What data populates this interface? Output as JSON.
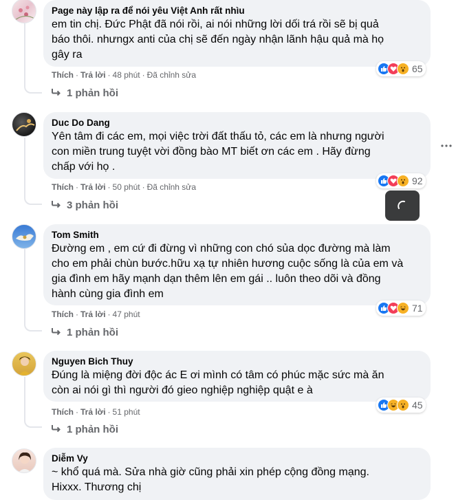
{
  "actions": {
    "like": "Thích",
    "reply": "Trả lời",
    "edited": "Đã chỉnh sửa",
    "separator": "·"
  },
  "comments": [
    {
      "author": "Page này lập ra để nói yêu Việt Anh rất nhìu",
      "text": "em tin chị. Đức Phật đã nói rồi, ai nói những lời dối trá rồi sẽ bị quả\nbáo thôi. nhưngx anti của chị sẽ đến ngày nhận lãnh hậu quả mà họ\ngây ra",
      "time": "48 phút",
      "reaction_count": "65",
      "reactions": [
        "like-icon",
        "love-icon",
        "wow-icon"
      ],
      "replies": "1 phản hồi"
    },
    {
      "author": "Duc Do Dang",
      "text": "Yên tâm đi các em, mọi việc trời đất thấu tỏ, các em là nhưng người\ncon miền trung tuyệt vời đồng bào MT biết ơn các em . Hãy đừng\nchấp với họ .",
      "time": "50 phút",
      "reaction_count": "92",
      "reactions": [
        "like-icon",
        "love-icon",
        "wow-icon"
      ],
      "replies": "3 phản hồi"
    },
    {
      "author": "Tom Smith",
      "text": "Đường em , em cứ đi đừng vì những con chó sủa dọc đường mà làm\ncho em phải chùn bước.hữu xạ tự nhiên hương cuộc sống là của em và\ngia đình em hãy mạnh dạn thêm lên em gái .. luôn theo dõi và đồng\nhành cùng gia đình em",
      "time": "47 phút",
      "reaction_count": "71",
      "reactions": [
        "like-icon",
        "love-icon",
        "haha-icon"
      ],
      "replies": "1 phản hồi"
    },
    {
      "author": "Nguyen Bich Thuy",
      "text": "Đúng là miệng đời độc ác E ơi mình có tâm có phúc mặc sức mà ăn\ncòn ai nói gì thì người đó gieo nghiệp nghiệp quật e à",
      "time": "51 phút",
      "reaction_count": "45",
      "reactions": [
        "like-icon",
        "haha-icon",
        "wow-icon"
      ],
      "replies": "1 phản hồi"
    },
    {
      "author": "Diễm Vy",
      "text": "~ khổ quá mà. Sửa nhà giờ cũng phải xin phép cộng đồng mạng.\nHixxx. Thương chị"
    }
  ],
  "colors": {
    "bubble": "#f0f2f5",
    "secondary_text": "#65676b",
    "like": "#1877f2",
    "love": "#f33e58",
    "wow": "#f7b125"
  }
}
